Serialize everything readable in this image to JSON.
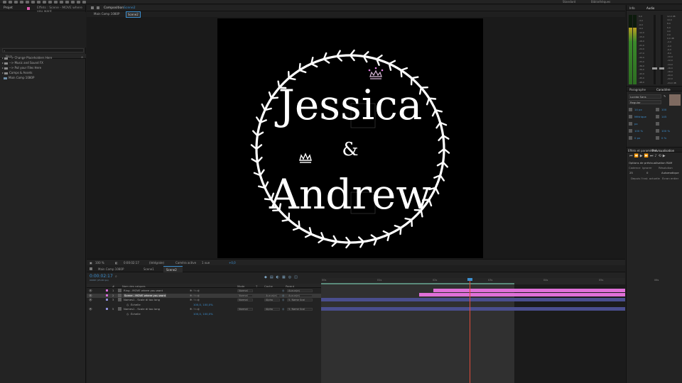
{
  "topbar": {
    "right_labels": [
      "Standard",
      "Bibliothèques"
    ]
  },
  "project": {
    "tab_label": "Projet",
    "effects_tab": "Effets : Scene - MOVE where you want",
    "search_placeholder": "",
    "column_name": "Nom",
    "items": [
      {
        "label": "--> Change Placeholders Here",
        "type": "folder"
      },
      {
        "label": "--> Music and Sound FX",
        "type": "folder"
      },
      {
        "label": "--> Put your Files Here",
        "type": "folder"
      },
      {
        "label": "Comps & Assets",
        "type": "folder"
      },
      {
        "label": "Main Comp 1080P",
        "type": "comp"
      }
    ]
  },
  "composition": {
    "tab_label": "Composition",
    "tab_comp": "Scene2",
    "sub_tabs": [
      "Main Comp 1080P",
      "Scene2"
    ],
    "title_top": "Jessica",
    "ampersand": "&",
    "title_bottom": "Andrew",
    "footer": {
      "zoom": "100 %",
      "timecode": "0:00:02:17",
      "resolution": "(Intégrale)",
      "camera": "Caméra active",
      "views": "1 vue",
      "offset": "+0,0"
    }
  },
  "right_panel": {
    "tabs_top": [
      "Info",
      "Audio"
    ],
    "meter_scale_left": [
      "0,0",
      "-3,0",
      "-6,0",
      "-9,0",
      "-12,0",
      "-15,0",
      "-18,0",
      "-21,0",
      "-24,0",
      "-27,0",
      "-30,0",
      "-33,0",
      "-36,0",
      "-39,0",
      "-42,0",
      "-45,0",
      "-48,0"
    ],
    "meter_scale_right": [
      "12,0 dB",
      "10,0",
      "8,0",
      "6,0",
      "4,0",
      "2,0",
      "0,0 dB",
      "-2,0",
      "-4,0",
      "-6,0",
      "-8,0",
      "-10,0",
      "-12,0",
      "-14,0",
      "-16,0",
      "-18,0",
      "-20,0",
      "-22,0",
      "-24,0 dB"
    ],
    "tabs_mid": [
      "Paragraphe",
      "Caractère"
    ],
    "font_name": "Lucida Sans",
    "font_style": "Regular",
    "char_rows": [
      [
        "14 px",
        "100"
      ],
      [
        "Métrique",
        "145"
      ],
      [
        "px",
        ""
      ],
      [
        "100 %",
        "100 %"
      ],
      [
        "0 px",
        "0 %"
      ]
    ],
    "tabs_bottom": [
      "Effets et paramètres",
      "Prévisualisation"
    ],
    "preview_options": "Options de prévisualisation RAM",
    "preview_labels": [
      "Cadence",
      "Ignorer",
      "Résolution"
    ],
    "preview_values": [
      "25",
      "0",
      "Automatique"
    ],
    "preview_checks": [
      "Depuis l'inst. actuelle",
      "Écran entier"
    ],
    "accent_color": "#3c8fcf"
  },
  "timeline": {
    "tabs": [
      "Main Comp 1080P",
      "Scene1",
      "Scene2"
    ],
    "timecode": "0:00:02:17",
    "timecode_fps": "00067 (25.00 ips)",
    "columns": [
      "#",
      "Nom des calques",
      "Mode",
      "T",
      "Cache",
      "Parent"
    ],
    "ruler_labels": [
      "00s",
      "01s",
      "02s",
      "03s",
      "04s",
      "05s",
      "06s"
    ],
    "layers": [
      {
        "num": "1",
        "name": "Ring - MOVE where you want",
        "color": "#d56ad5",
        "mode": "Normal",
        "cache": "",
        "parent": "Aucun(e)"
      },
      {
        "num": "2",
        "name": "Scene - MOVE where you want",
        "color": "#d56ad5",
        "mode": "Normal",
        "cache": "Aucun(e)",
        "parent": "Aucun(e)"
      },
      {
        "num": "3",
        "name": "Names1 - Scale di too long",
        "color": "#8c8cd6",
        "mode": "Normal",
        "cache": "Alpha",
        "parent": "5. Name Scal"
      },
      {
        "num": "",
        "name": "Échelle",
        "color": "",
        "mode": "",
        "cache": "",
        "parent": "",
        "value": "100,0, 100,0%"
      },
      {
        "num": "5",
        "name": "Names1 - Scale di too long",
        "color": "#8c8cd6",
        "mode": "Normal",
        "cache": "Alpha",
        "parent": "5. Name Scal"
      },
      {
        "num": "",
        "name": "Échelle",
        "color": "",
        "mode": "",
        "cache": "",
        "parent": "",
        "value": "100,0, 100,0%"
      }
    ],
    "playhead_color": "#e04a3a",
    "bar_color_pink": "#e070d8",
    "bar_color_blue": "#4a4e8e"
  }
}
